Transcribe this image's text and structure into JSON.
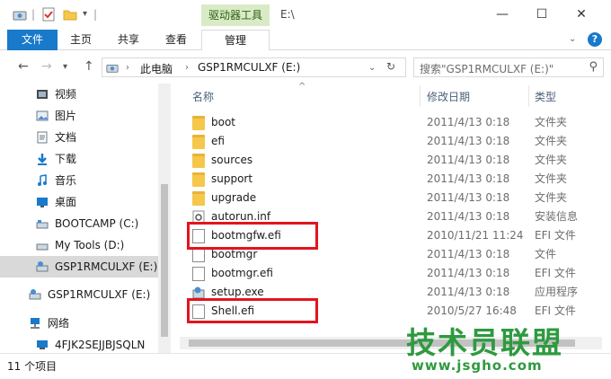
{
  "window": {
    "title": "E:\\",
    "context_tab": "驱动器工具",
    "min_glyph": "—",
    "max_glyph": "☐",
    "close_glyph": "✕"
  },
  "ribbon": {
    "file": "文件",
    "home": "主页",
    "share": "共享",
    "view": "查看",
    "manage": "管理"
  },
  "address": {
    "crumbs": [
      "此电脑",
      "GSP1RMCULXF (E:)"
    ],
    "search_placeholder": "搜索\"GSP1RMCULXF (E:)\""
  },
  "nav": {
    "items": [
      {
        "label": "视频",
        "icon": "video-icon"
      },
      {
        "label": "图片",
        "icon": "pictures-icon"
      },
      {
        "label": "文档",
        "icon": "documents-icon"
      },
      {
        "label": "下载",
        "icon": "download-icon"
      },
      {
        "label": "音乐",
        "icon": "music-icon"
      },
      {
        "label": "桌面",
        "icon": "desktop-icon"
      },
      {
        "label": "BOOTCAMP (C:)",
        "icon": "drive-icon"
      },
      {
        "label": "My Tools (D:)",
        "icon": "drive-icon"
      },
      {
        "label": "GSP1RMCULXF (E:)",
        "icon": "dvd-drive-icon",
        "selected": true
      },
      {
        "label": "GSP1RMCULXF (E:)",
        "icon": "dvd-drive-icon"
      },
      {
        "label": "网络",
        "icon": "network-icon"
      },
      {
        "label": "4FJK2SEJJBJSQLN",
        "icon": "computer-icon"
      }
    ]
  },
  "columns": {
    "name": "名称",
    "date": "修改日期",
    "type": "类型"
  },
  "files": [
    {
      "name": "boot",
      "date": "2011/4/13 0:18",
      "type": "文件夹",
      "kind": "folder"
    },
    {
      "name": "efi",
      "date": "2011/4/13 0:18",
      "type": "文件夹",
      "kind": "folder"
    },
    {
      "name": "sources",
      "date": "2011/4/13 0:18",
      "type": "文件夹",
      "kind": "folder"
    },
    {
      "name": "support",
      "date": "2011/4/13 0:18",
      "type": "文件夹",
      "kind": "folder"
    },
    {
      "name": "upgrade",
      "date": "2011/4/13 0:18",
      "type": "文件夹",
      "kind": "folder"
    },
    {
      "name": "autorun.inf",
      "date": "2011/4/13 0:18",
      "type": "安装信息",
      "kind": "file"
    },
    {
      "name": "bootmgfw.efi",
      "date": "2010/11/21 11:24",
      "type": "EFI 文件",
      "kind": "file",
      "highlight": true
    },
    {
      "name": "bootmgr",
      "date": "2011/4/13 0:18",
      "type": "文件",
      "kind": "file"
    },
    {
      "name": "bootmgr.efi",
      "date": "2011/4/13 0:18",
      "type": "EFI 文件",
      "kind": "file"
    },
    {
      "name": "setup.exe",
      "date": "2011/4/13 0:18",
      "type": "应用程序",
      "kind": "app"
    },
    {
      "name": "Shell.efi",
      "date": "2010/5/27 16:48",
      "type": "EFI 文件",
      "kind": "file",
      "highlight": true
    }
  ],
  "status": {
    "count": "11 个项目"
  },
  "watermark": {
    "title": "技术员联盟",
    "url": "www.jsgho.com"
  },
  "colors": {
    "accent": "#1979ca",
    "context_tab": "#d8ebc6",
    "highlight_box": "#e3141e",
    "watermark": "#2e9a3f"
  }
}
